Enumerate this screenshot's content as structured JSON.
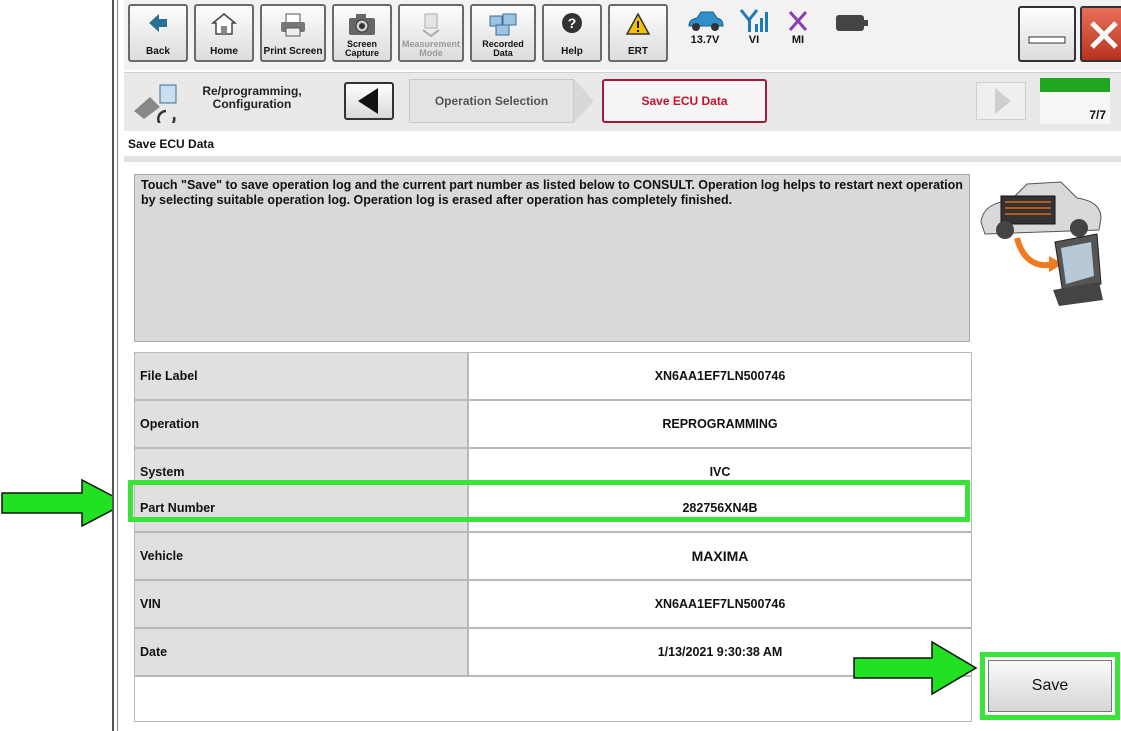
{
  "toolbar": {
    "buttons": [
      {
        "label": "Back",
        "icon": "back-arrow-icon"
      },
      {
        "label": "Home",
        "icon": "home-icon"
      },
      {
        "label": "Print Screen",
        "icon": "printer-icon"
      },
      {
        "label": "Screen Capture",
        "icon": "camera-icon"
      },
      {
        "label": "Measurement Mode",
        "icon": "measurement-icon"
      },
      {
        "label": "Recorded Data",
        "icon": "recorded-data-icon"
      },
      {
        "label": "Help",
        "icon": "help-icon"
      },
      {
        "label": "ERT",
        "icon": "warning-icon"
      }
    ],
    "status": {
      "voltage": "13.7V",
      "vi": "VI",
      "mi": "MI"
    }
  },
  "breadcrumb": {
    "title": "Re/programming, Configuration",
    "steps": [
      "Operation Selection",
      "Save ECU Data"
    ],
    "progress_text": "7/7",
    "progress_fraction": 1.0
  },
  "section_title": "Save ECU Data",
  "instructions": "Touch \"Save\" to save operation log and the current part number as listed below to CONSULT. Operation log helps to restart next operation by selecting suitable operation log. Operation log is erased after operation has completely finished.",
  "table": [
    {
      "key": "File Label",
      "value": "XN6AA1EF7LN500746"
    },
    {
      "key": "Operation",
      "value": "REPROGRAMMING"
    },
    {
      "key": "System",
      "value": "IVC"
    },
    {
      "key": "Part Number",
      "value": "282756XN4B"
    },
    {
      "key": "Vehicle",
      "value": "MAXIMA"
    },
    {
      "key": "VIN",
      "value": "XN6AA1EF7LN500746"
    },
    {
      "key": "Date",
      "value": "1/13/2021 9:30:38 AM"
    }
  ],
  "save_label": "Save",
  "colors": {
    "highlight": "#39e339",
    "active_step": "#c4112f",
    "progress": "#1fa51f"
  }
}
